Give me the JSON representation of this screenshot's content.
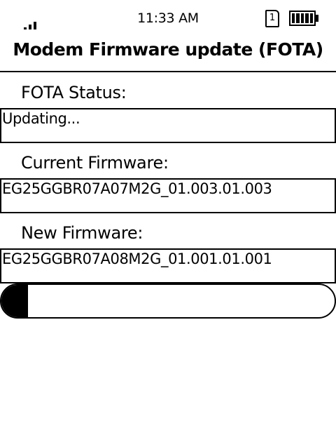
{
  "status_bar": {
    "time": "11:33 AM",
    "sim_slot": "1",
    "signal_level": 3,
    "battery_level": 5
  },
  "title": "Modem Firmware update (FOTA)",
  "fota_status": {
    "label": "FOTA Status:",
    "value": "Updating..."
  },
  "current_firmware": {
    "label": "Current Firmware:",
    "value": "EG25GGBR07A07M2G_01.003.01.003"
  },
  "new_firmware": {
    "label": "New Firmware:",
    "value": "EG25GGBR07A08M2G_01.001.01.001"
  },
  "progress": {
    "fraction": 0.08
  }
}
